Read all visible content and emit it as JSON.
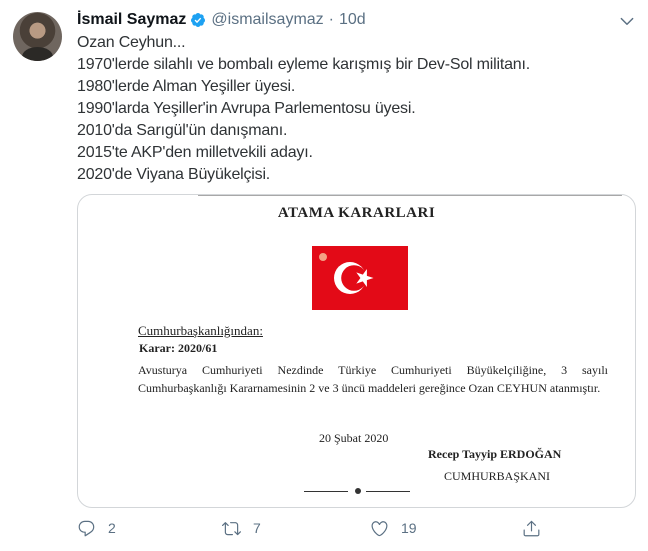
{
  "tweet": {
    "display_name": "İsmail Saymaz",
    "handle": "@ismailsaymaz",
    "separator": "·",
    "time": "10d",
    "text": "Ozan Ceyhun...\n1970'lerde silahlı ve bombalı eyleme karışmış bir Dev-Sol militanı.\n1980'lerde Alman Yeşiller üyesi.\n1990'larda Yeşiller'in Avrupa Parlementosu üyesi.\n2010'da Sarıgül'ün danışmanı.\n2015'te AKP'den milletvekili adayı.\n2020'de Viyana Büyükelçisi."
  },
  "document": {
    "title": "ATAMA KARARLARI",
    "issuer": "Cumhurbaşkanlığından:",
    "decree": "Karar: 2020/61",
    "body": "Avusturya Cumhuriyeti Nezdinde Türkiye Cumhuriyeti Büyükelçiliğine, 3 sayılı Cumhurbaşkanlığı Kararnamesinin 2 ve 3 üncü maddeleri gereğince Ozan CEYHUN atanmıştır.",
    "date": "20 Şubat 2020",
    "signer": "Recep Tayyip ERDOĞAN",
    "signer_title": "CUMHURBAŞKANI"
  },
  "actions": {
    "reply_count": "2",
    "retweet_count": "7",
    "like_count": "19"
  },
  "colors": {
    "flag_red": "#e30a17",
    "verified_blue": "#1da1f2",
    "muted_text": "#5b7083"
  }
}
